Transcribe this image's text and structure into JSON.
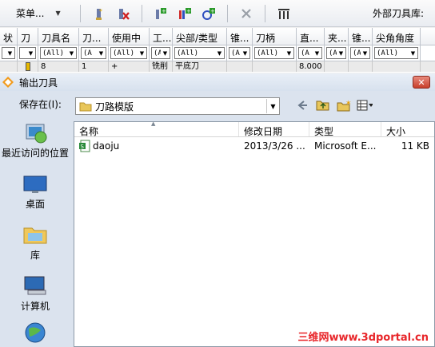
{
  "toolbar": {
    "menu_label": "菜单...",
    "external_library_label": "外部刀具库:"
  },
  "grid": {
    "headers": [
      "状",
      "刀",
      "刀具名",
      "刀...",
      "使用中",
      "工...",
      "尖部/类型",
      "锥...",
      "刀柄",
      "直...",
      "夹...",
      "锥...",
      "尖角角度"
    ],
    "filters": [
      "",
      "",
      "(All)",
      "(A",
      "(All)",
      "(A",
      "(All)",
      "(A",
      "(All)",
      "(A",
      "(A",
      "(A",
      "(All)"
    ],
    "row": [
      "",
      "",
      "8",
      "1",
      "+",
      "铣削",
      "平底刀",
      "",
      "",
      "8.000",
      "",
      "",
      ""
    ]
  },
  "dialog": {
    "title": "输出刀具",
    "close_label": "✕",
    "save_in_label": "保存在(I):",
    "path_value": "刀路模版",
    "places": [
      {
        "label": "最近访问的位置",
        "icon": "recent-places-icon"
      },
      {
        "label": "桌面",
        "icon": "desktop-icon"
      },
      {
        "label": "库",
        "icon": "libraries-icon"
      },
      {
        "label": "计算机",
        "icon": "computer-icon"
      },
      {
        "label": "",
        "icon": "network-icon"
      }
    ],
    "columns": [
      "名称",
      "修改日期",
      "类型",
      "大小"
    ],
    "files": [
      {
        "name": "daoju",
        "date": "2013/3/26 ...",
        "type": "Microsoft E...",
        "size": "11 KB"
      }
    ]
  },
  "watermark": "三维网www.3dportal.cn"
}
